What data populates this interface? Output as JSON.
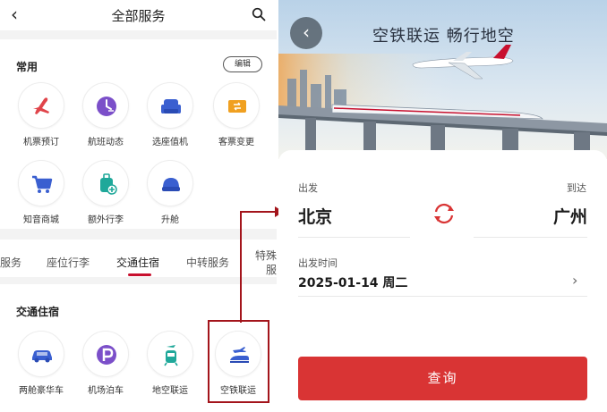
{
  "left": {
    "title": "全部服务",
    "common": {
      "title": "常用",
      "edit_label": "编辑",
      "items": [
        {
          "label": "机票预订",
          "icon": "plane-icon"
        },
        {
          "label": "航班动态",
          "icon": "flight-status-icon"
        },
        {
          "label": "选座值机",
          "icon": "seat-icon"
        },
        {
          "label": "客票变更",
          "icon": "ticket-change-icon"
        },
        {
          "label": "知音商城",
          "icon": "cart-icon"
        },
        {
          "label": "额外行李",
          "icon": "luggage-icon"
        },
        {
          "label": "升舱",
          "icon": "upgrade-seat-icon"
        }
      ]
    },
    "tabs": [
      {
        "label": "服务"
      },
      {
        "label": "座位行李"
      },
      {
        "label": "交通住宿"
      },
      {
        "label": "中转服务"
      }
    ],
    "tab_tail": {
      "line1": "特殊",
      "line2": "服"
    },
    "transport": {
      "title": "交通住宿",
      "items": [
        {
          "label": "两舱豪华车",
          "icon": "car-icon"
        },
        {
          "label": "机场泊车",
          "icon": "parking-icon"
        },
        {
          "label": "地空联运",
          "icon": "ground-air-icon"
        },
        {
          "label": "空铁联运",
          "icon": "air-rail-icon"
        }
      ]
    }
  },
  "right": {
    "slogan": "空铁联运   畅行地空",
    "from_label": "出发",
    "to_label": "到达",
    "from_city": "北京",
    "to_city": "广州",
    "date_label": "出发时间",
    "date_value": "2025-01-14 周二",
    "query_label": "查询"
  },
  "colors": {
    "accent": "#d93434",
    "highlight_border": "#a3141b",
    "icon_red": "#e0444a",
    "icon_purple": "#7b4fc9",
    "icon_blue": "#3a5fd0",
    "icon_orange": "#f0a020",
    "icon_teal": "#1fa89a"
  }
}
